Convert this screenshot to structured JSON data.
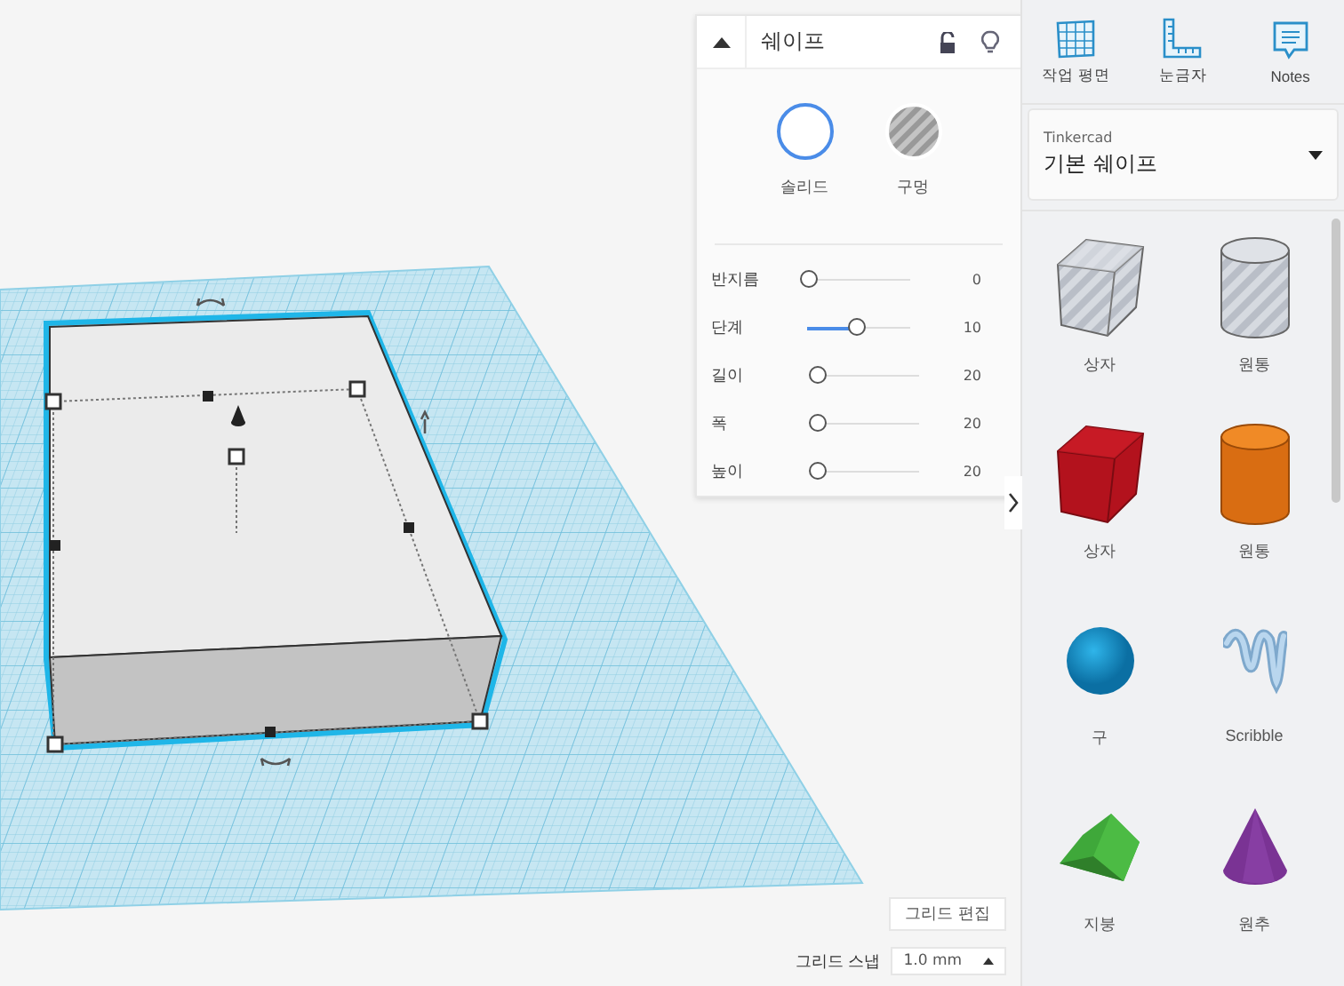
{
  "inspector": {
    "title": "쉐이프",
    "expanded": true,
    "modes": [
      {
        "label": "솔리드",
        "kind": "solid",
        "selected": true
      },
      {
        "label": "구멍",
        "kind": "hole",
        "selected": false
      }
    ],
    "sliders": [
      {
        "label": "반지름",
        "level": 0,
        "reading": "0"
      },
      {
        "label": "단계",
        "level": 0.47,
        "reading": "10"
      },
      {
        "label": "길이",
        "level": 0,
        "reading": "20"
      },
      {
        "label": "폭",
        "level": 0,
        "reading": "20"
      },
      {
        "label": "높이",
        "level": 0,
        "reading": "20"
      }
    ]
  },
  "grid": {
    "edit_label": "그리드 편집",
    "snap_label": "그리드 스냅",
    "snap_value": "1.0 mm"
  },
  "toolbar": [
    {
      "label": "작업 평면",
      "kind": "workplane"
    },
    {
      "label": "눈금자",
      "kind": "ruler"
    },
    {
      "label": "Notes",
      "kind": "notes"
    }
  ],
  "library": {
    "source": "Tinkercad",
    "name": "기본 쉐이프"
  },
  "shapes": [
    {
      "label": "상자",
      "kind": "box-hole"
    },
    {
      "label": "원통",
      "kind": "cylinder-hole"
    },
    {
      "label": "상자",
      "kind": "box"
    },
    {
      "label": "원통",
      "kind": "cylinder"
    },
    {
      "label": "구",
      "kind": "sphere"
    },
    {
      "label": "Scribble",
      "kind": "scribble"
    },
    {
      "label": "지붕",
      "kind": "roof"
    },
    {
      "label": "원추",
      "kind": "cone"
    }
  ]
}
